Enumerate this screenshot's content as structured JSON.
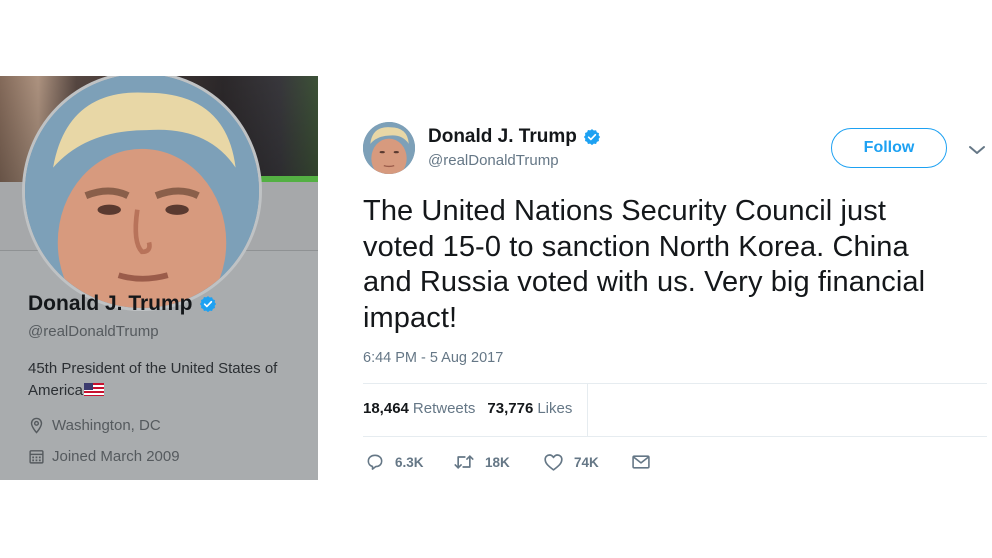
{
  "profile": {
    "name": "Donald J. Trump",
    "handle": "@realDonaldTrump",
    "bio": "45th President of the United States of America",
    "location": "Washington, DC",
    "joined": "Joined March 2009"
  },
  "tweet": {
    "author_name": "Donald J. Trump",
    "author_handle": "@realDonaldTrump",
    "follow_label": "Follow",
    "text": "The United Nations Security Council just voted 15-0 to sanction North Korea. China and Russia voted with us. Very big financial impact!",
    "timestamp": "6:44 PM - 5 Aug 2017",
    "retweets_count": "18,464",
    "retweets_label": "Retweets",
    "likes_count": "73,776",
    "likes_label": "Likes",
    "reply_count": "6.3K",
    "retweet_action_count": "18K",
    "like_action_count": "74K"
  },
  "colors": {
    "accent": "#1da1f2",
    "muted_text": "#657786",
    "profile_card_bg": "#a9acae"
  },
  "icons": [
    "verified-badge-icon",
    "chevron-down-icon",
    "location-pin-icon",
    "calendar-icon",
    "reply-icon",
    "retweet-icon",
    "heart-icon",
    "message-icon",
    "us-flag-icon"
  ]
}
